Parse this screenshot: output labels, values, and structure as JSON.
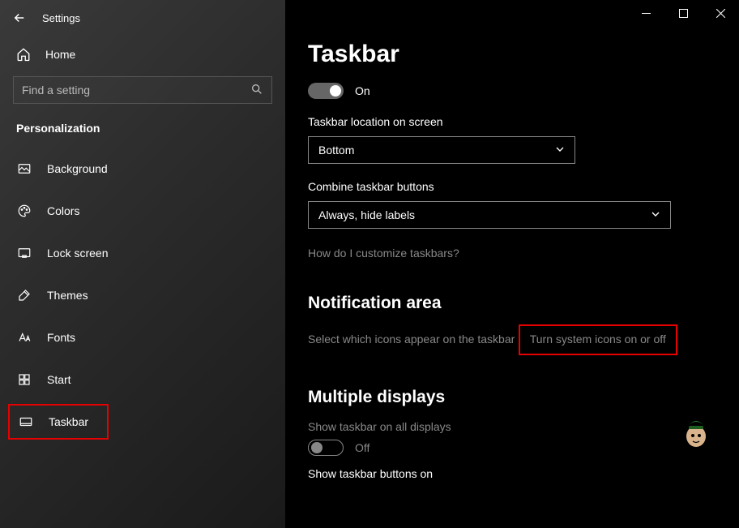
{
  "window": {
    "title": "Settings"
  },
  "sidebar": {
    "home_label": "Home",
    "search_placeholder": "Find a setting",
    "section_title": "Personalization",
    "items": [
      {
        "label": "Background"
      },
      {
        "label": "Colors"
      },
      {
        "label": "Lock screen"
      },
      {
        "label": "Themes"
      },
      {
        "label": "Fonts"
      },
      {
        "label": "Start"
      },
      {
        "label": "Taskbar"
      }
    ]
  },
  "main": {
    "title": "Taskbar",
    "toggle1_label": "On",
    "location_label": "Taskbar location on screen",
    "location_value": "Bottom",
    "combine_label": "Combine taskbar buttons",
    "combine_value": "Always, hide labels",
    "customize_link": "How do I customize taskbars?",
    "notif_head": "Notification area",
    "notif_link1": "Select which icons appear on the taskbar",
    "notif_link2": "Turn system icons on or off",
    "multi_head": "Multiple displays",
    "multi_label": "Show taskbar on all displays",
    "multi_toggle_label": "Off",
    "multi_buttons_label": "Show taskbar buttons on"
  }
}
